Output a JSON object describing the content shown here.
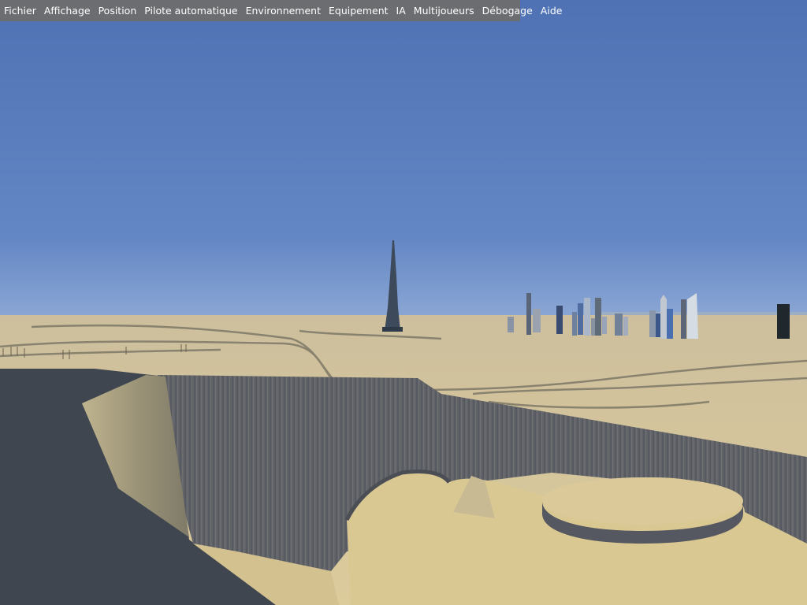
{
  "app": {
    "menubar": {
      "items": [
        {
          "id": "fichier",
          "label": "Fichier"
        },
        {
          "id": "affichage",
          "label": "Affichage"
        },
        {
          "id": "position",
          "label": "Position"
        },
        {
          "id": "pilote",
          "label": "Pilote automatique"
        },
        {
          "id": "environnement",
          "label": "Environnement"
        },
        {
          "id": "equipement",
          "label": "Equipement"
        },
        {
          "id": "ia",
          "label": "IA"
        },
        {
          "id": "multijoueurs",
          "label": "Multijoueurs"
        },
        {
          "id": "debogage",
          "label": "Débogage"
        },
        {
          "id": "aide",
          "label": "Aide"
        }
      ]
    }
  },
  "colors": {
    "menubar_bg": "#6b6d70",
    "menubar_text": "#ffffff",
    "sky_top": "#5075b5",
    "sky_horizon": "#7f9ed0",
    "sand": "#d9c79a",
    "cliff": "#5c5f66",
    "shadow": "#3a4048"
  }
}
